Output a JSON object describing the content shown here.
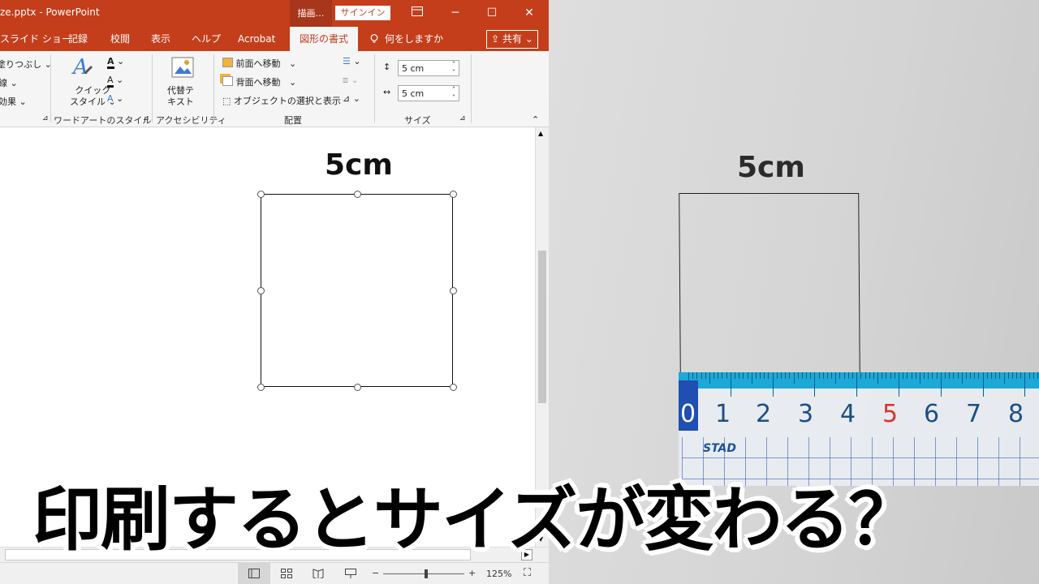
{
  "window": {
    "title": "ze.pptx  -  PowerPoint",
    "context_tab": "描画…",
    "signin": "サインイン",
    "ribbon_display_icon": "ribbon-display-icon",
    "minimize": "─",
    "maximize": "☐",
    "close": "✕"
  },
  "tabs": [
    {
      "label": "スライド ショー"
    },
    {
      "label": "記録"
    },
    {
      "label": "校閲"
    },
    {
      "label": "表示"
    },
    {
      "label": "ヘルプ"
    },
    {
      "label": "Acrobat"
    },
    {
      "label": "図形の書式",
      "active": true
    },
    {
      "label": "何をしますか"
    }
  ],
  "share_label": "共有",
  "ribbon": {
    "shape_fill": "塗りつぶし",
    "shape_outline": "線",
    "shape_effects": "効果",
    "quick_style_line1": "クイック",
    "quick_style_line2": "スタイル",
    "wordart_group": "ワードアートのスタイル",
    "alt_text_line1": "代替テ",
    "alt_text_line2": "キスト",
    "accessibility_group": "アクセシビリティ",
    "bring_forward": "前面へ移動",
    "send_backward": "背面へ移動",
    "selection_pane": "オブジェクトの選択と表示",
    "arrange_group": "配置",
    "height_value": "5 cm",
    "width_value": "5 cm",
    "size_group": "サイズ"
  },
  "slide": {
    "label": "5cm"
  },
  "statusbar": {
    "zoom_minus": "−",
    "zoom_plus": "+",
    "zoom_level": "125%"
  },
  "photo": {
    "label": "5cm",
    "ruler_numbers": [
      "0",
      "1",
      "2",
      "3",
      "4",
      "5",
      "6",
      "7",
      "8"
    ],
    "ruler_brand": "STAD"
  },
  "caption": "印刷するとサイズが変わる？",
  "colors": {
    "accent": "#c43e1c",
    "ruler_blue": "#1ea8d8",
    "ruler_five": "#d9332a"
  }
}
